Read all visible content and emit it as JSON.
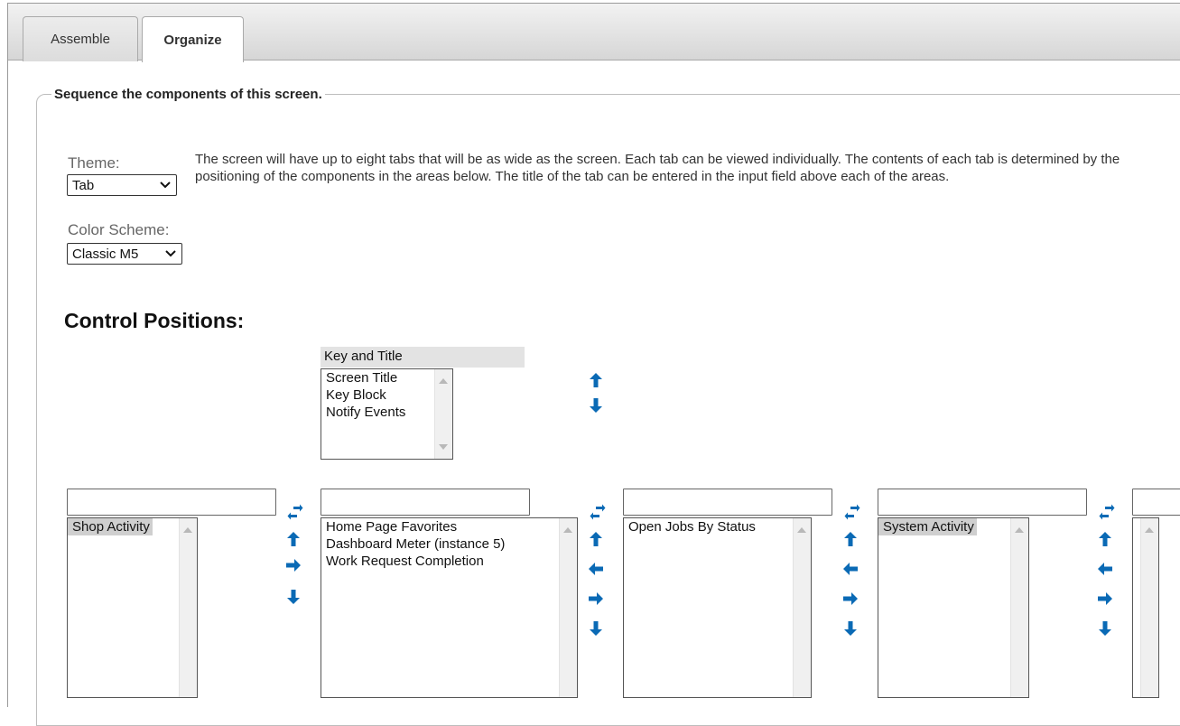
{
  "tabs": [
    {
      "label": "Assemble"
    },
    {
      "label": "Organize"
    }
  ],
  "legend": "Sequence the components of this screen.",
  "theme": {
    "label": "Theme:",
    "value": "Tab"
  },
  "color_scheme": {
    "label": "Color Scheme:",
    "value": "Classic M5"
  },
  "description": "The screen will have up to eight tabs that will be as wide as the screen. Each tab can be viewed individually. The contents of each tab is determined by the positioning of the components in the areas below. The title of the tab can be entered in the input field above each of the areas.",
  "control_positions_title": "Control Positions:",
  "key_and_title": {
    "header": "Key and Title",
    "items": [
      "Screen Title",
      "Key Block",
      "Notify Events"
    ]
  },
  "areas": [
    {
      "title_value": "",
      "items": [
        "Shop Activity"
      ]
    },
    {
      "title_value": "",
      "items": [
        "Home Page Favorites",
        "Dashboard Meter (instance 5)",
        "Work Request Completion"
      ]
    },
    {
      "title_value": "",
      "items": [
        "Open Jobs By Status"
      ]
    },
    {
      "title_value": "",
      "items": [
        "System Activity"
      ]
    },
    {
      "title_value": "",
      "items": []
    }
  ],
  "colors": {
    "accent_icon": "#0a6ab5",
    "tabbar_gradient_top": "#f2f2f2",
    "highlight": "#cfcfcf"
  },
  "icons": [
    "swap-icon",
    "arrow-up-icon",
    "arrow-down-icon",
    "arrow-left-icon",
    "arrow-right-icon",
    "chevron-down-icon"
  ]
}
